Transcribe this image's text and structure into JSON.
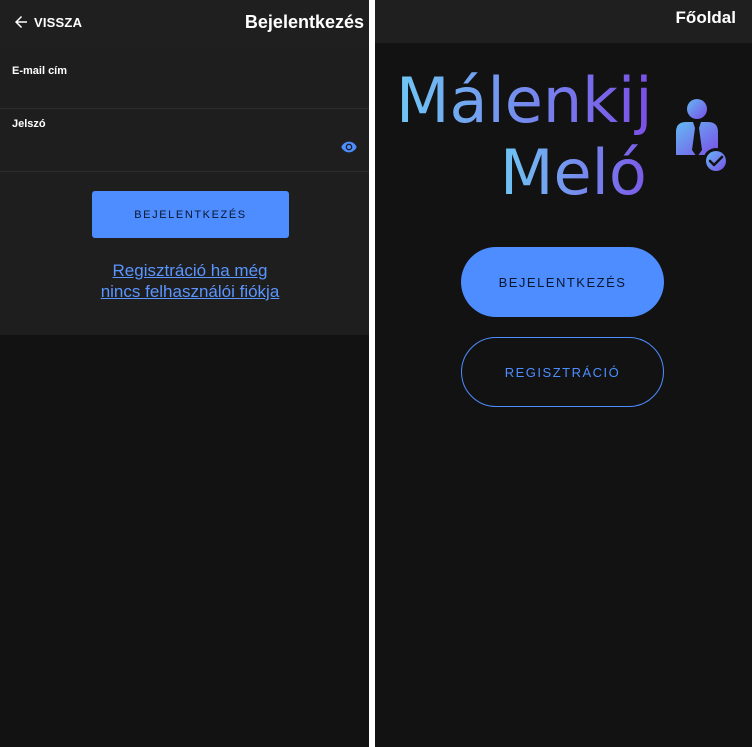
{
  "login_screen": {
    "header": {
      "back_label": "VISSZA",
      "back_icon": "arrow-left-icon",
      "title": "Bejelentkezés"
    },
    "form": {
      "email_label": "E-mail cím",
      "email_value": "",
      "password_label": "Jelszó",
      "password_value": "",
      "password_toggle_icon": "eye-icon"
    },
    "login_button_label": "BEJELENTKEZÉS",
    "register_link_line1": "Regisztráció ha még",
    "register_link_line2": "nincs felhasználói fiókja"
  },
  "home_screen": {
    "header": {
      "title": "Főoldal"
    },
    "logo": {
      "line1": "Málenkij",
      "line2": "Meló",
      "icon": "worker-checkmark-icon"
    },
    "login_button_label": "BEJELENTKEZÉS",
    "register_button_label": "REGISZTRÁCIÓ"
  },
  "colors": {
    "background": "#121212",
    "header": "#1f1f1f",
    "card": "#1e1e1e",
    "accent": "#4d8dff",
    "logo_gradient_start": "#6fc7f5",
    "logo_gradient_end": "#7b4fe6"
  }
}
